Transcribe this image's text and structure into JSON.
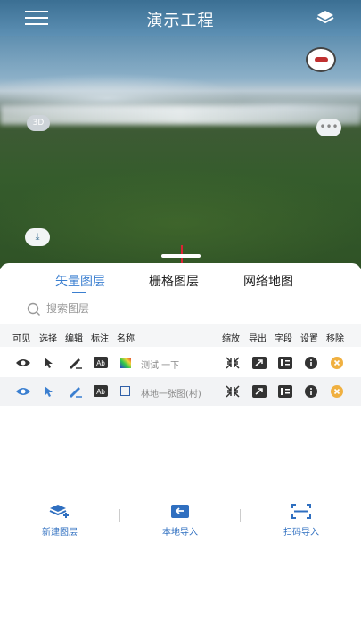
{
  "app": {
    "title": "演示工程"
  },
  "map": {
    "btn_3d": "3D",
    "chat_label": "•••"
  },
  "tabs": [
    {
      "label": "矢量图层",
      "active": true
    },
    {
      "label": "栅格图层",
      "active": false
    },
    {
      "label": "网络地图",
      "active": false
    }
  ],
  "search": {
    "placeholder": "搜索图层"
  },
  "columns": {
    "visible": "可见",
    "select": "选择",
    "edit": "编辑",
    "label": "标注",
    "name": "名称",
    "zoom": "缩放",
    "export": "导出",
    "fields": "字段",
    "settings": "设置",
    "remove": "移除"
  },
  "layers": [
    {
      "name": "测试 一下",
      "visible_color": "#333333",
      "swatch": "gradient"
    },
    {
      "name": "林地一张图(村)",
      "visible_color": "#3b7fd0",
      "swatch": "outline"
    }
  ],
  "actions": {
    "new_layer": "新建图层",
    "local_import": "本地导入",
    "scan_import": "扫码导入"
  },
  "colors": {
    "accent": "#3b7fd0",
    "remove": "#f0b040"
  }
}
